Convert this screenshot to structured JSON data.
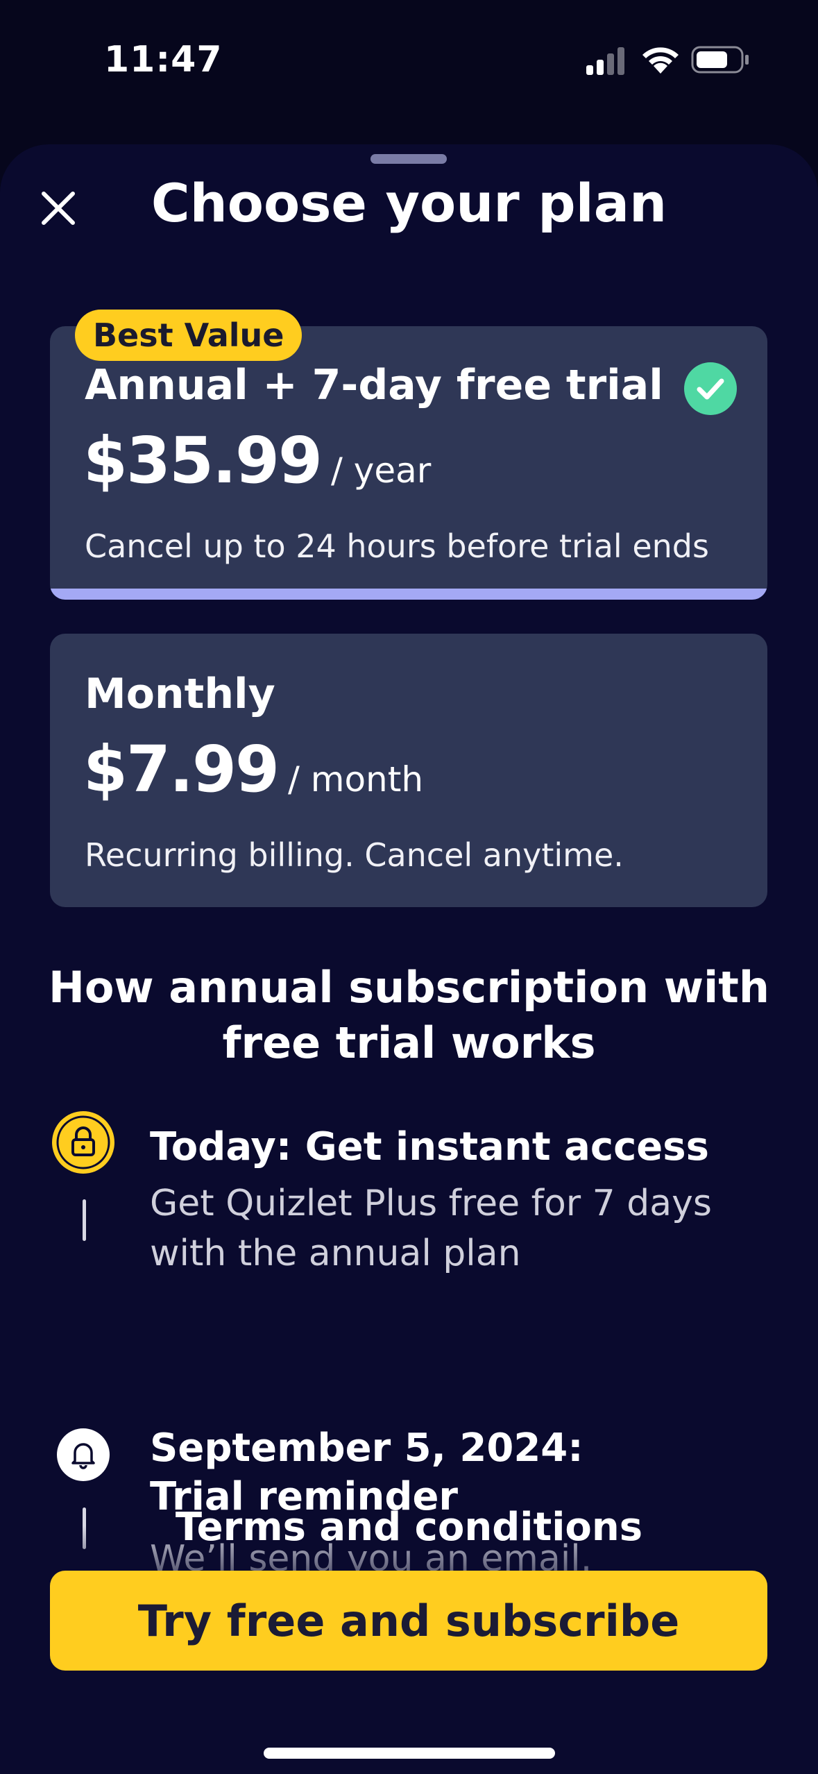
{
  "status_bar": {
    "time": "11:47"
  },
  "sheet": {
    "title": "Choose your plan",
    "close_icon": "close-icon"
  },
  "plans": {
    "annual": {
      "badge": "Best Value",
      "name": "Annual + 7-day free trial",
      "price": "$35.99",
      "period": "/ year",
      "note": "Cancel up to 24 hours before trial ends",
      "selected": true
    },
    "monthly": {
      "name": "Monthly",
      "price": "$7.99",
      "period": "/ month",
      "note": "Recurring billing. Cancel anytime.",
      "selected": false
    }
  },
  "how_it_works": {
    "title_line1": "How annual subscription with",
    "title_line2": "free trial works",
    "steps": [
      {
        "icon": "lock-icon",
        "title": "Today: Get instant access",
        "description": "Get Quizlet Plus free for 7 days with the annual plan"
      },
      {
        "icon": "bell-icon",
        "title_line1": "September 5, 2024:",
        "title_line2": "Trial reminder",
        "description": "We’ll send you an email."
      }
    ]
  },
  "footer": {
    "terms_label": "Terms and conditions",
    "cta_label": "Try free and subscribe"
  },
  "colors": {
    "background": "#0a0a2e",
    "card": "#2f3756",
    "accent_yellow": "#ffcd1f",
    "selected_bar": "#a4a9f5",
    "check_green": "#4fd8a3"
  }
}
